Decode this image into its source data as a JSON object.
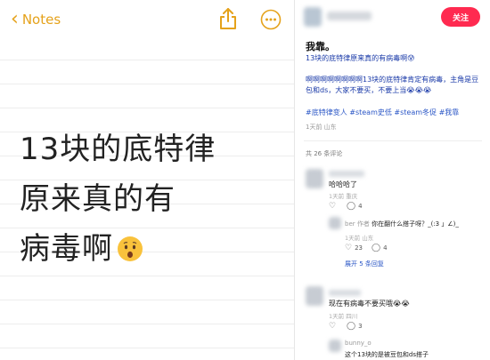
{
  "notes": {
    "back_label": "Notes",
    "share_icon": "share-icon",
    "more_icon": "ellipsis-circle-icon",
    "accent_color": "#e5a21b",
    "body_lines": [
      "13块的底特律",
      "原来真的有",
      "病毒啊"
    ],
    "body_emoji": "worried-face-emoji"
  },
  "post": {
    "follow_label": "关注",
    "follow_color": "#ff2a50",
    "title": "我靠。",
    "line1": "13块的底特律原来真的有病毒啊😰",
    "line2": "啊啊啊啊啊啊啊啊13块的底特律肯定有病毒，主角是豆包和ds，大家不要买，不要上当😭😭😭",
    "tags": "#底特律变人 #steam史低 #steam冬促 #我靠",
    "meta": "1天前 山东",
    "comment_count": "共 26 条评论",
    "comments": [
      {
        "text": "哈哈哈了",
        "time": "1天前 重庆",
        "likes": "",
        "replies": "4"
      },
      {
        "name": "ber 作者",
        "text": "你在翻什么搭子呀？_(:3 」∠)_",
        "time": "1天前 山东",
        "likes": "23",
        "replies": "4",
        "expand": "展开 5 条回复"
      },
      {
        "text": "现在有病毒不要买哦😭😭",
        "time": "1天前 四川",
        "likes": "",
        "replies": "3"
      },
      {
        "name": "bunny_o",
        "text": "这个13块的是被豆包和ds搭子"
      }
    ]
  }
}
